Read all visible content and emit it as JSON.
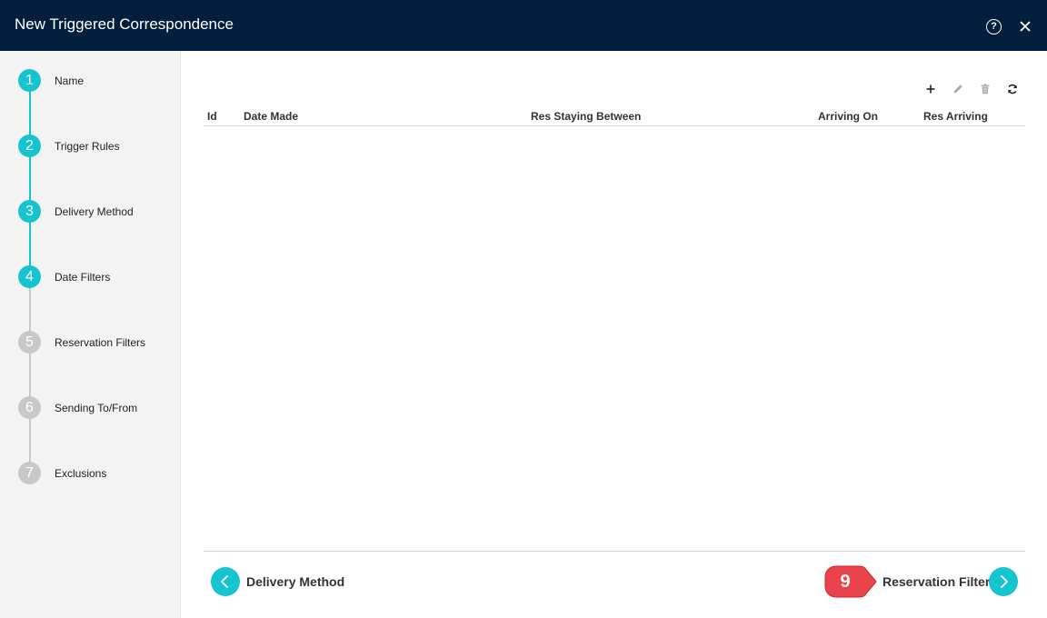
{
  "window": {
    "title": "New Triggered Correspondence",
    "help_icon": "question-circle-icon",
    "help_glyph": "?",
    "close_icon": "close-icon"
  },
  "steps": [
    {
      "number": "1",
      "label": "Name",
      "state": "active"
    },
    {
      "number": "2",
      "label": "Trigger Rules",
      "state": "active"
    },
    {
      "number": "3",
      "label": "Delivery Method",
      "state": "active"
    },
    {
      "number": "4",
      "label": "Date Filters",
      "state": "active"
    },
    {
      "number": "5",
      "label": "Reservation Filters",
      "state": "inactive"
    },
    {
      "number": "6",
      "label": "Sending To/From",
      "state": "inactive"
    },
    {
      "number": "7",
      "label": "Exclusions",
      "state": "inactive"
    }
  ],
  "toolbar": {
    "icons": [
      "plus-icon",
      "pencil-icon",
      "trash-icon",
      "refresh-icon"
    ]
  },
  "table": {
    "columns": [
      "Id",
      "Date Made",
      "Res Staying Between",
      "Arriving On",
      "Res Arriving"
    ],
    "rows": []
  },
  "footer": {
    "back_label": "Delivery Method",
    "next_label": "Reservation Filters"
  },
  "annotation": {
    "number": "9"
  },
  "colors": {
    "titlebar": "#011e3d",
    "accent": "#16c4cf",
    "inactive_step": "#c8c8c8",
    "callout": "#e8434a"
  }
}
